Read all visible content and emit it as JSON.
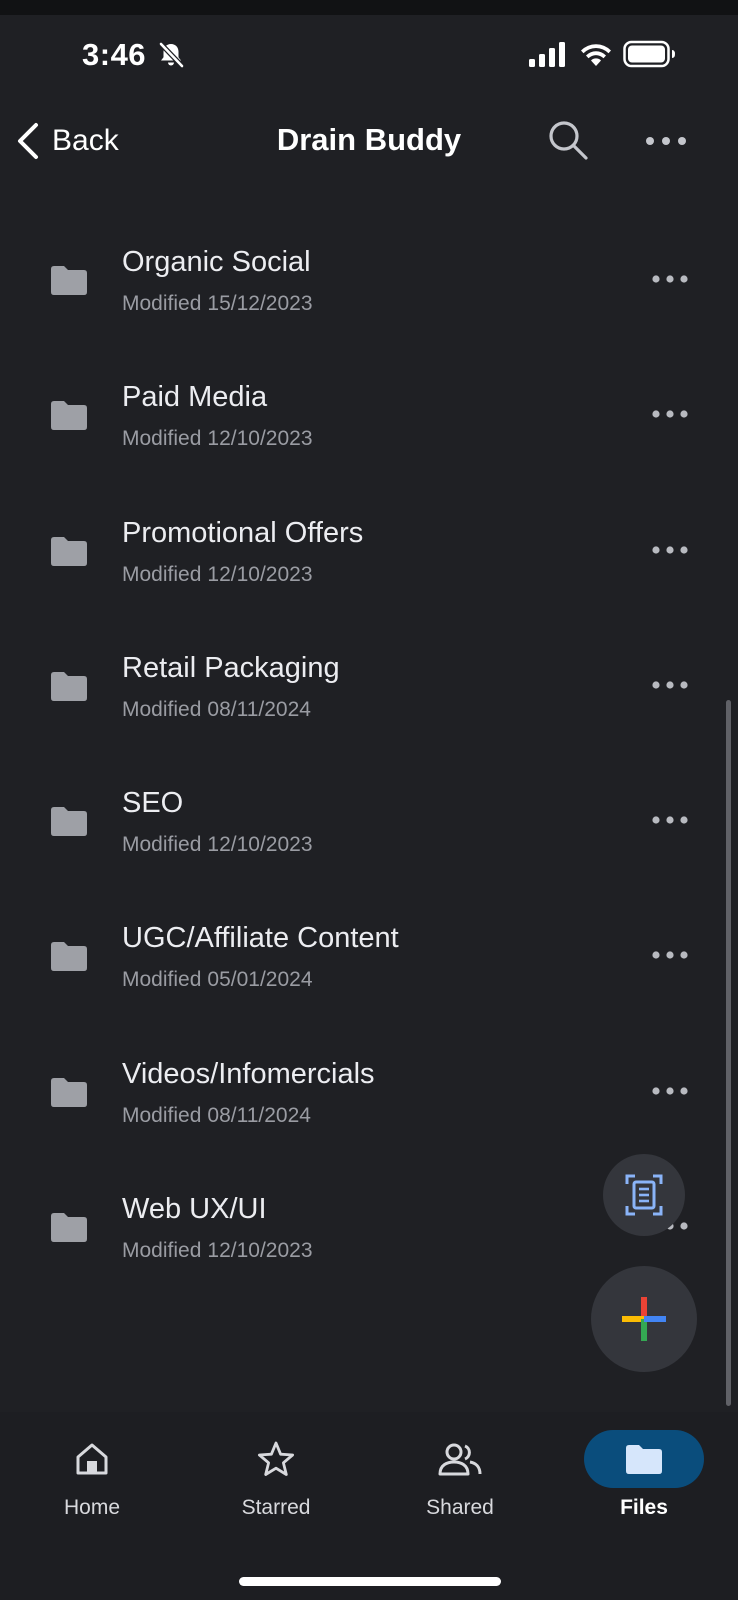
{
  "status_bar": {
    "time": "3:46"
  },
  "header": {
    "back_label": "Back",
    "title": "Drain Buddy"
  },
  "files": [
    {
      "name": "Organic Social",
      "modified_label": "Modified",
      "modified_date": "15/12/2023"
    },
    {
      "name": "Paid Media",
      "modified_label": "Modified",
      "modified_date": "12/10/2023"
    },
    {
      "name": "Promotional Offers",
      "modified_label": "Modified",
      "modified_date": "12/10/2023"
    },
    {
      "name": "Retail Packaging",
      "modified_label": "Modified",
      "modified_date": "08/11/2024"
    },
    {
      "name": "SEO",
      "modified_label": "Modified",
      "modified_date": "12/10/2023"
    },
    {
      "name": "UGC/Affiliate Content",
      "modified_label": "Modified",
      "modified_date": "05/01/2024"
    },
    {
      "name": "Videos/Infomercials",
      "modified_label": "Modified",
      "modified_date": "08/11/2024"
    },
    {
      "name": "Web UX/UI",
      "modified_label": "Modified",
      "modified_date": "12/10/2023"
    }
  ],
  "bottom_nav": {
    "items": [
      {
        "label": "Home",
        "icon": "home-icon",
        "active": false
      },
      {
        "label": "Starred",
        "icon": "star-icon",
        "active": false
      },
      {
        "label": "Shared",
        "icon": "people-icon",
        "active": false
      },
      {
        "label": "Files",
        "icon": "folder-icon",
        "active": true
      }
    ]
  },
  "colors": {
    "background": "#1f2024",
    "active_nav_pill": "#0a4d7c",
    "folder": "#9ea0a6",
    "plus_red": "#ea4335",
    "plus_yellow": "#fbbc04",
    "plus_green": "#34a853",
    "plus_blue": "#4285f4",
    "scan_icon": "#8ab4f8"
  }
}
